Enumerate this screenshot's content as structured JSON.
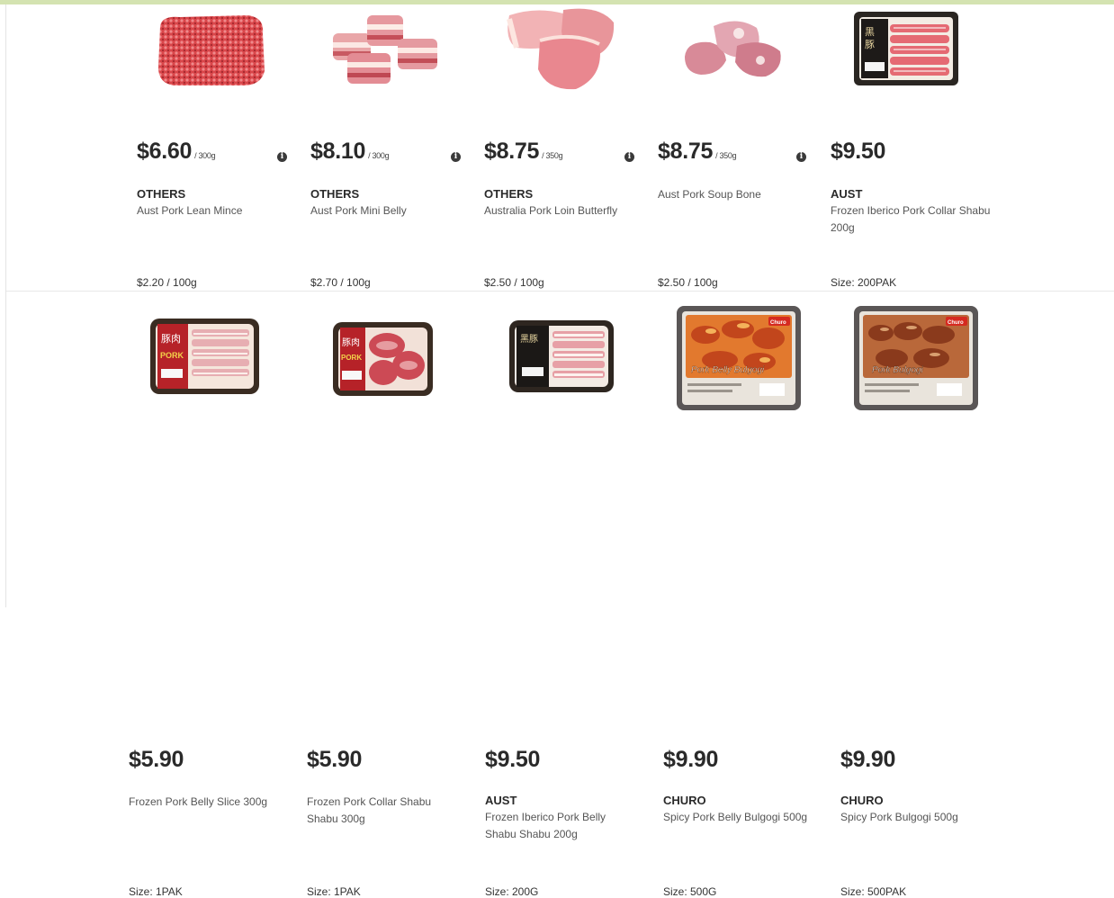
{
  "products": [
    {
      "price": "$6.60",
      "unit": "/ 300g",
      "has_info": true,
      "brand": "OTHERS",
      "name": "Aust Pork Lean Mince",
      "meta": "$2.20 / 100g",
      "image": "minced-pork-image"
    },
    {
      "price": "$8.10",
      "unit": "/ 300g",
      "has_info": true,
      "brand": "OTHERS",
      "name": "Aust Pork Mini Belly",
      "meta": "$2.70 / 100g",
      "image": "pork-belly-chunks-image"
    },
    {
      "price": "$8.75",
      "unit": "/ 350g",
      "has_info": true,
      "brand": "OTHERS",
      "name": "Australia Pork Loin Butterfly",
      "meta": "$2.50 / 100g",
      "image": "pork-loin-image"
    },
    {
      "price": "$8.75",
      "unit": "/ 350g",
      "has_info": true,
      "brand": "",
      "name": "Aust Pork Soup Bone",
      "meta": "$2.50 / 100g",
      "image": "pork-soup-bone-image"
    },
    {
      "price": "$9.50",
      "unit": "",
      "has_info": false,
      "brand": "AUST",
      "name": "Frozen Iberico Pork Collar Shabu 200g",
      "meta": "Size: 200PAK",
      "image": "iberico-collar-pack-image"
    },
    {
      "price": "$5.90",
      "unit": "",
      "has_info": false,
      "brand": "",
      "name": "Frozen Pork Belly Slice 300g",
      "meta": "Size: 1PAK",
      "image": "pork-belly-slice-pack-image"
    },
    {
      "price": "$5.90",
      "unit": "",
      "has_info": false,
      "brand": "",
      "name": "Frozen Pork Collar Shabu Shabu 300g",
      "meta": "Size: 1PAK",
      "image": "pork-collar-pack-image"
    },
    {
      "price": "$9.50",
      "unit": "",
      "has_info": false,
      "brand": "AUST",
      "name": "Frozen Iberico Pork Belly Shabu Shabu 200g",
      "meta": "Size: 200G",
      "image": "iberico-belly-pack-image"
    },
    {
      "price": "$9.90",
      "unit": "",
      "has_info": false,
      "brand": "CHURO",
      "name": "Spicy Pork Belly Bulgogi 500g",
      "meta": "Size: 500G",
      "image": "bulgogi-belly-tray-image"
    },
    {
      "price": "$9.90",
      "unit": "",
      "has_info": false,
      "brand": "CHURO",
      "name": "Spicy Pork Bulgogi 500g",
      "meta": "Size: 500PAK",
      "image": "bulgogi-tray-image"
    }
  ],
  "info_glyph": "i",
  "pack_labels": {
    "pork_banner": "PORK",
    "iberico_pack_text": "IBERICO PORK COLLAR",
    "iberico_belly_pack_text": "IBERICO PORK BELLY",
    "churo_brand": "Churo",
    "tray_label_belly": "Pork Belly Bulgogi",
    "tray_label_plain": "Pork Bulgogi"
  },
  "colors": {
    "accent_bar": "#d4e3b1",
    "price_text": "#2a2a2a",
    "name_text": "#555555"
  }
}
